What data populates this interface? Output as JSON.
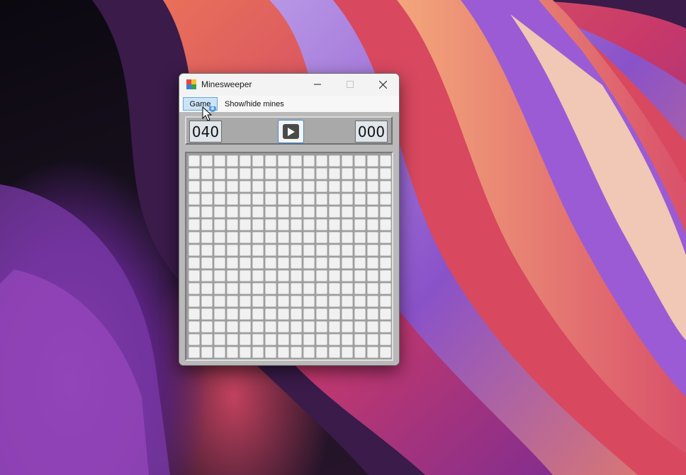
{
  "window": {
    "title": "Minesweeper",
    "icon": "minesweeper-app-icon",
    "controls": {
      "minimize": "minimize-icon",
      "maximize": "maximize-icon",
      "close": "close-icon"
    }
  },
  "menu": {
    "items": [
      {
        "label": "Game",
        "state": "open"
      },
      {
        "label": "Show/hide mines"
      }
    ]
  },
  "status": {
    "mines_remaining": "040",
    "timer": "000",
    "play_button_icon": "play-icon"
  },
  "board": {
    "rows": 16,
    "columns": 16,
    "cell_state": "unrevealed"
  },
  "colors": {
    "accent": "#3b8ad8",
    "menu_highlight": "#cce4f7",
    "board_background": "#9e9e9e"
  }
}
